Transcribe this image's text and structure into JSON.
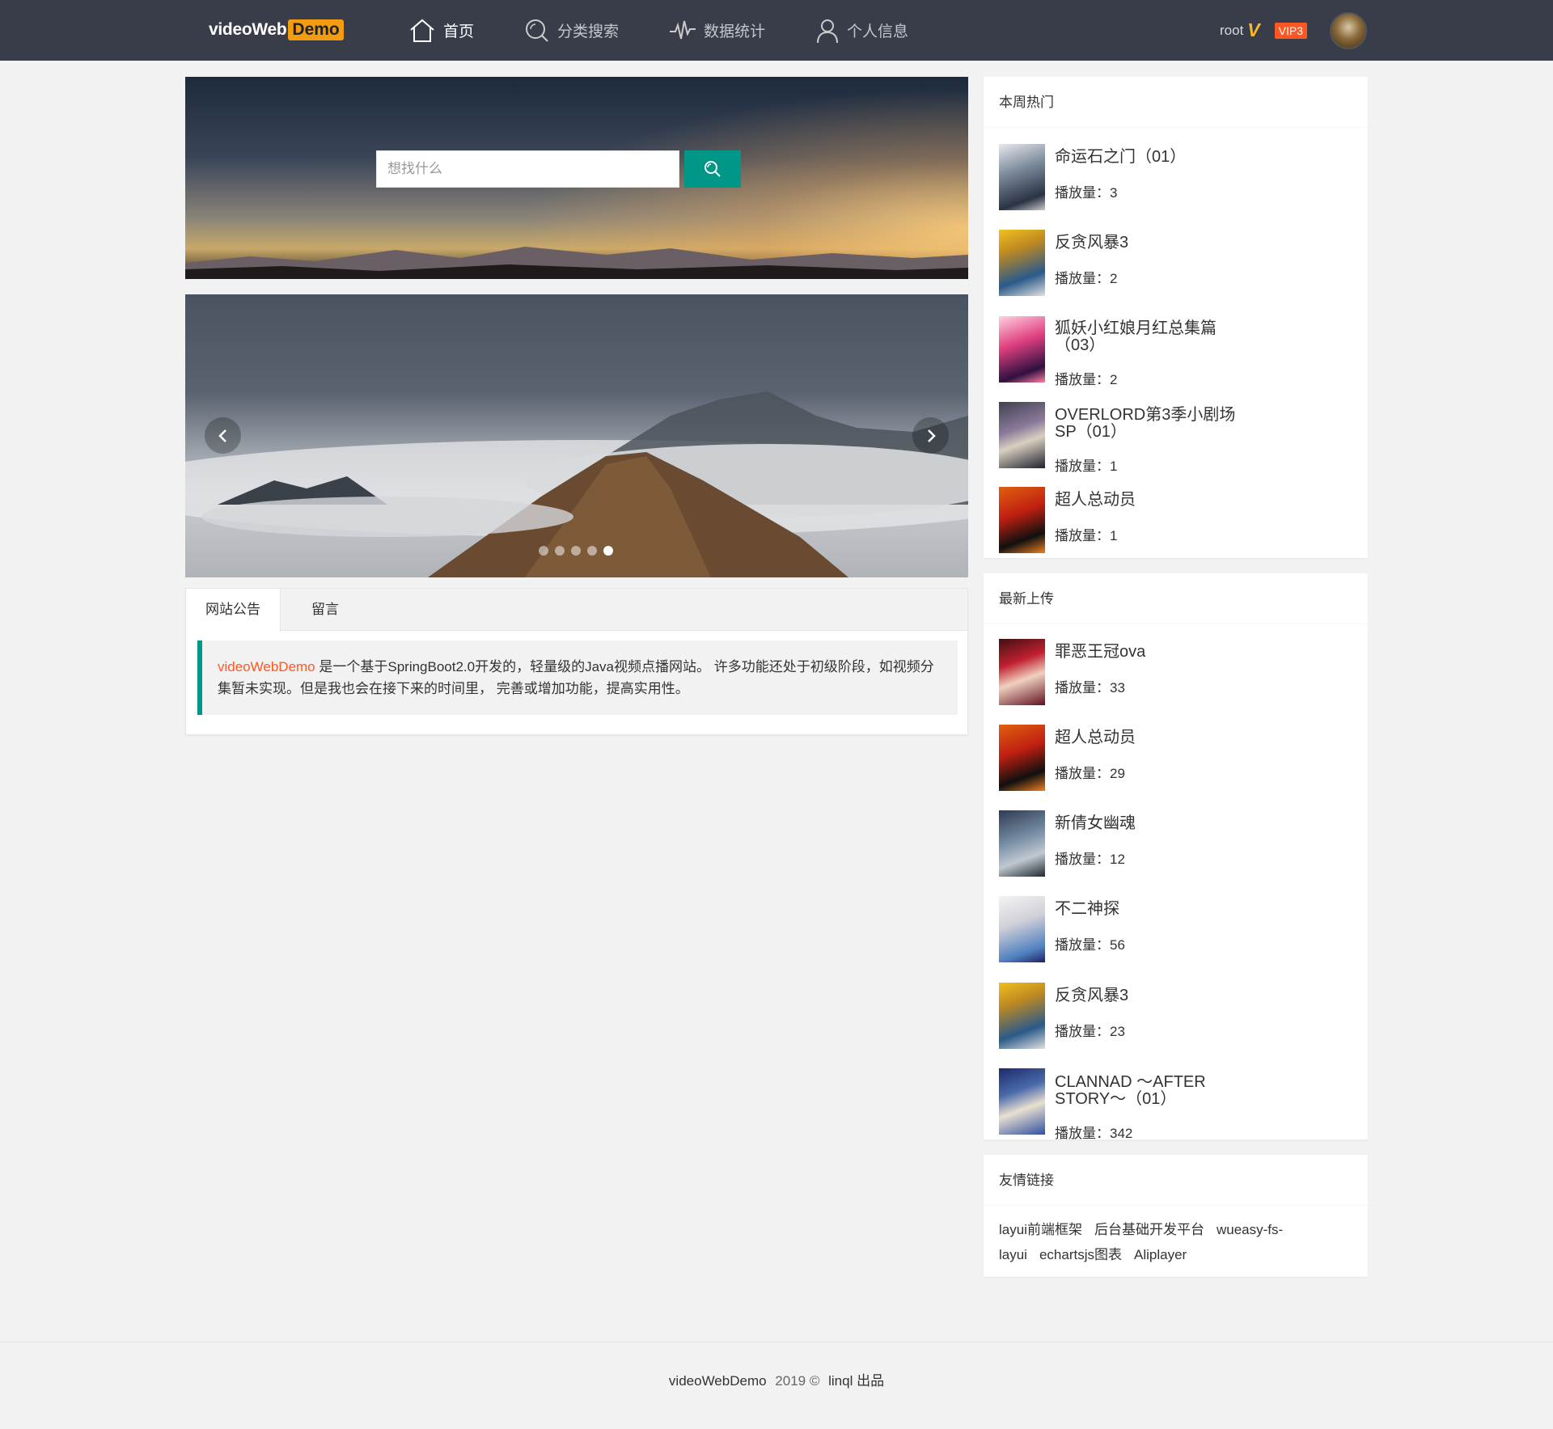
{
  "header": {
    "logo_text": "videoWeb",
    "logo_badge": "Demo",
    "nav": [
      {
        "label": "首页",
        "icon": "home-icon",
        "active": true
      },
      {
        "label": "分类搜索",
        "icon": "search-icon"
      },
      {
        "label": "数据统计",
        "icon": "pulse-icon"
      },
      {
        "label": "个人信息",
        "icon": "user-icon"
      }
    ],
    "user": {
      "name": "root",
      "vip_mark": "V",
      "vip_level": "VIP3"
    }
  },
  "search": {
    "placeholder": "想找什么"
  },
  "carousel": {
    "slides": 5,
    "active_index": 4
  },
  "tabs": {
    "items": [
      "网站公告",
      "留言"
    ],
    "active": 0,
    "notice_highlight": "videoWebDemo",
    "notice_text": " 是一个基于SpringBoot2.0开发的，轻量级的Java视频点播网站。 许多功能还处于初级阶段，如视频分集暂未实现。但是我也会在接下来的时间里， 完善或增加功能，提高实用性。"
  },
  "hot_week": {
    "title": "本周热门",
    "items": [
      {
        "title": "命运石之门（01）",
        "plays": "播放量：3"
      },
      {
        "title": "反贪风暴3",
        "plays": "播放量：2"
      },
      {
        "title": "狐妖小红娘月红总集篇（03）",
        "plays": "播放量：2"
      },
      {
        "title": "OVERLORD第3季小剧场SP（01）",
        "plays": "播放量：1"
      },
      {
        "title": "超人总动员",
        "plays": "播放量：1"
      }
    ]
  },
  "latest": {
    "title": "最新上传",
    "items": [
      {
        "title": "罪恶王冠ova",
        "plays": "播放量：33"
      },
      {
        "title": "超人总动员",
        "plays": "播放量：29"
      },
      {
        "title": "新倩女幽魂",
        "plays": "播放量：12"
      },
      {
        "title": "不二神探",
        "plays": "播放量：56"
      },
      {
        "title": "反贪风暴3",
        "plays": "播放量：23"
      },
      {
        "title": "CLANNAD ～AFTER STORY～（01）",
        "plays": "播放量：342"
      }
    ]
  },
  "friend_links": {
    "title": "友情链接",
    "items": [
      "layui前端框架",
      "后台基础开发平台",
      "wueasy-fs-layui",
      "echartsjs图表",
      "Aliplayer"
    ]
  },
  "footer": {
    "site": "videoWebDemo",
    "year": "2019 ©",
    "author": "linql 出品"
  },
  "colors": {
    "header_bg": "#393d49",
    "accent": "#009688",
    "highlight": "#ff5722",
    "vip": "#fbb829"
  }
}
